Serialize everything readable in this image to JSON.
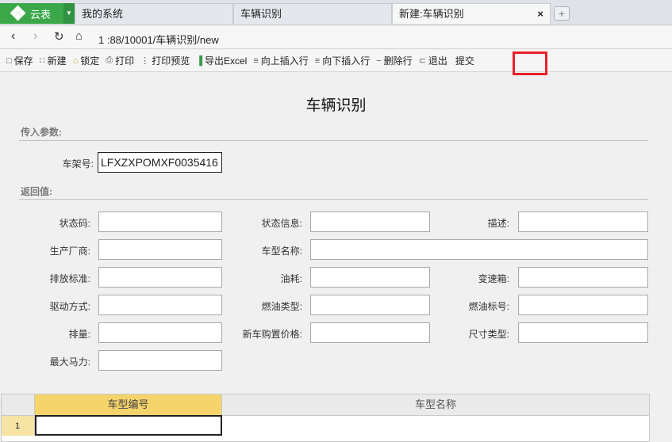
{
  "tabs": {
    "app_name": "云表",
    "items": [
      "我的系统",
      "车辆识别",
      "新建:车辆识别"
    ],
    "close": "×",
    "add": "+"
  },
  "address": {
    "url": "1      :88/10001/车辆识别/new"
  },
  "toolbar": {
    "save": "保存",
    "new": "新建",
    "lock": "锁定",
    "print": "打印",
    "print_preview": "打印预览",
    "export_excel": "导出Excel",
    "insert_above": "向上插入行",
    "insert_below": "向下插入行",
    "delete_row": "删除行",
    "exit": "退出",
    "submit": "提交"
  },
  "form": {
    "title": "车辆识别",
    "input_section": "传入参数:",
    "vin_label": "车架号:",
    "vin_value": "LFXZXPOMXF0035416",
    "return_section": "返回值:",
    "labels": {
      "status_code": "状态码:",
      "status_info": "状态信息:",
      "description": "描述:",
      "manufacturer": "生产厂商:",
      "model_name": "车型名称:",
      "emission": "排放标准:",
      "fuel_consumption": "油耗:",
      "gearbox": "变速箱:",
      "drive": "驱动方式:",
      "fuel_type": "燃油类型:",
      "fuel_grade": "燃油标号:",
      "displacement": "排量:",
      "price": "新车购置价格:",
      "size_type": "尺寸类型:",
      "max_power": "最大马力:"
    }
  },
  "grid": {
    "columns": [
      "车型编号",
      "车型名称"
    ],
    "row_number": "1"
  }
}
